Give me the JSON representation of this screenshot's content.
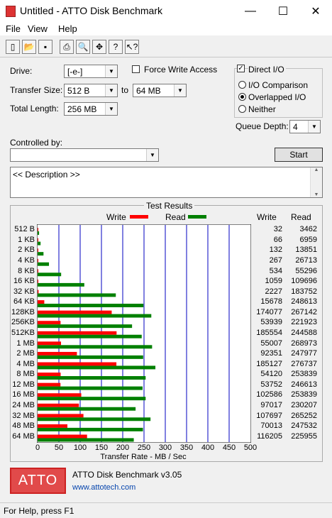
{
  "window": {
    "title": "Untitled - ATTO Disk Benchmark",
    "minimize": "—",
    "maximize": "☐",
    "close": "✕"
  },
  "menu": [
    "File",
    "View",
    "Help"
  ],
  "toolbar": [
    {
      "name": "new-icon",
      "glyph": "▯"
    },
    {
      "name": "open-icon",
      "glyph": "📂"
    },
    {
      "name": "save-icon",
      "glyph": "▪"
    },
    {
      "name": "print-icon",
      "glyph": "⎙"
    },
    {
      "name": "print-preview-icon",
      "glyph": "🔍"
    },
    {
      "name": "move-icon",
      "glyph": "✥"
    },
    {
      "name": "help-icon",
      "glyph": "?"
    },
    {
      "name": "context-help-icon",
      "glyph": "↖?"
    }
  ],
  "form": {
    "drive_label": "Drive:",
    "drive_value": "[-e-]",
    "transfer_size_label": "Transfer Size:",
    "transfer_from": "512 B",
    "to_label": "to",
    "transfer_to": "64 MB",
    "total_length_label": "Total Length:",
    "total_length": "256 MB",
    "force_write_access": "Force Write Access",
    "direct_io": "Direct I/O",
    "io_comparison": "I/O Comparison",
    "overlapped_io": "Overlapped I/O",
    "neither": "Neither",
    "queue_depth_label": "Queue Depth:",
    "queue_depth": "4",
    "controlled_by_label": "Controlled by:",
    "controlled_by_value": "",
    "start_button": "Start",
    "description": "<< Description >>"
  },
  "results": {
    "title": "Test Results",
    "write_legend": "Write",
    "read_legend": "Read",
    "write_col": "Write",
    "read_col": "Read",
    "xlabel": "Transfer Rate - MB / Sec",
    "colors": {
      "write": "#ff0000",
      "read": "#008000",
      "grid": "#0000c0"
    }
  },
  "chart_data": {
    "type": "bar",
    "categories": [
      "512 B",
      "1 KB",
      "2 KB",
      "4 KB",
      "8 KB",
      "16 KB",
      "32 KB",
      "64 KB",
      "128KB",
      "256KB",
      "512KB",
      "1 MB",
      "2 MB",
      "4 MB",
      "8 MB",
      "12 MB",
      "16 MB",
      "24 MB",
      "32 MB",
      "48 MB",
      "64 MB"
    ],
    "series": [
      {
        "name": "Write",
        "values": [
          32,
          66,
          132,
          267,
          534,
          1059,
          2227,
          15678,
          174077,
          53939,
          185554,
          55007,
          92351,
          185127,
          54120,
          53752,
          102586,
          97017,
          107697,
          70013,
          116205
        ]
      },
      {
        "name": "Read",
        "values": [
          3462,
          6959,
          13851,
          26713,
          55296,
          109696,
          183752,
          248613,
          267142,
          221923,
          244588,
          268973,
          247977,
          276737,
          253839,
          246613,
          253839,
          230207,
          265252,
          247532,
          225955
        ]
      }
    ],
    "xlabel": "Transfer Rate - MB / Sec",
    "xticks": [
      0,
      50,
      100,
      150,
      200,
      250,
      300,
      350,
      400,
      450,
      500
    ],
    "xlim": [
      0,
      500
    ],
    "unit_note": "values in KB/s; plotted as MB/s"
  },
  "footer": {
    "logo": "ATTO",
    "product": "ATTO Disk Benchmark v3.05",
    "link": "www.attotech.com"
  },
  "status": "For Help, press F1"
}
